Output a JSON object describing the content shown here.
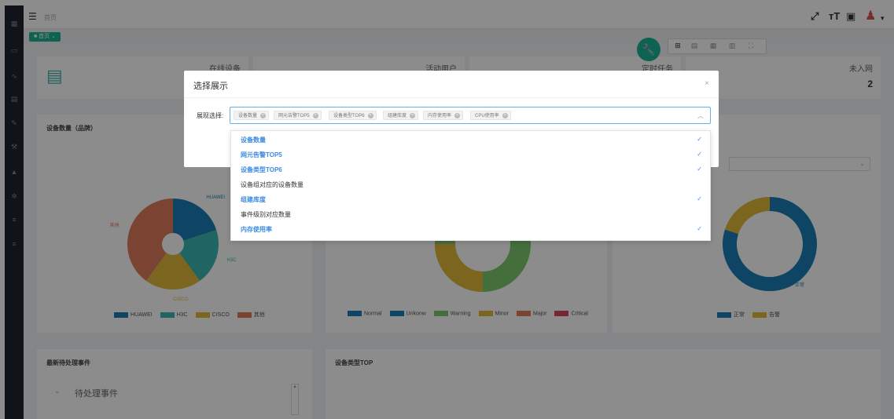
{
  "topbar": {
    "breadcrumb": "首页",
    "home_tag": "■ 首页 ⌄"
  },
  "stats": [
    {
      "label": "在线设备"
    },
    {
      "label": "活动用户"
    },
    {
      "label": "定时任务"
    },
    {
      "label": "未入网",
      "value": "2"
    }
  ],
  "panels": {
    "device_count_title": "设备数量（品牌）",
    "pie_labels": {
      "huawei": "HUAWEI",
      "h3c": "H3C",
      "cisco": "CISCO",
      "other": "其他"
    },
    "brand_legend": [
      "HUAWEI",
      "H3C",
      "CISCO",
      "其他"
    ],
    "alarm_legend": [
      "Normal",
      "Unkonw",
      "Warning",
      "Minor",
      "Major",
      "Critical"
    ],
    "status_legend": [
      "正常",
      "告警"
    ],
    "status_label": "正常",
    "pending_title": "最新待处理事件",
    "pending_item": "待处理事件",
    "device_type_title": "设备类型TOP"
  },
  "chart_data": [
    {
      "type": "pie",
      "title": "设备数量（品牌）",
      "categories": [
        "HUAWEI",
        "H3C",
        "CISCO",
        "其他"
      ],
      "values": [
        20,
        20,
        20,
        40
      ],
      "colors": [
        "#1b7eb8",
        "#3bb8b3",
        "#e0b83a",
        "#e07b5a"
      ],
      "note_hidden": false
    },
    {
      "type": "pie",
      "title": "",
      "categories": [
        "正常",
        "告警"
      ],
      "values": [
        80,
        20
      ],
      "colors": [
        "#1b7eb8",
        "#e0b83a"
      ]
    }
  ],
  "modal": {
    "title": "选择展示",
    "close": "×",
    "field_label": "展现选择:",
    "selected_tags": [
      "设备数量",
      "网元告警TOP5",
      "设备类型TOP6",
      "组建库度",
      "内存使用率",
      "CPU使用率"
    ],
    "options": [
      {
        "label": "设备数量",
        "selected": true
      },
      {
        "label": "网元告警TOP5",
        "selected": true
      },
      {
        "label": "设备类型TOP6",
        "selected": true
      },
      {
        "label": "设备组对应的设备数量",
        "selected": false
      },
      {
        "label": "组建库度",
        "selected": true
      },
      {
        "label": "事件级别对应数量",
        "selected": false
      },
      {
        "label": "内存使用率",
        "selected": true
      }
    ],
    "check_mark": "✓"
  },
  "colors": {
    "accent": "#1ab394",
    "sidebar": "#1f2330",
    "selected_option": "#3d8be1",
    "huawei": "#1b7eb8",
    "h3c": "#3bb8b3",
    "cisco": "#e0b83a",
    "other": "#e07b5a",
    "warning": "#7ec86f",
    "major": "#e07b5a",
    "critical": "#d9455f"
  }
}
